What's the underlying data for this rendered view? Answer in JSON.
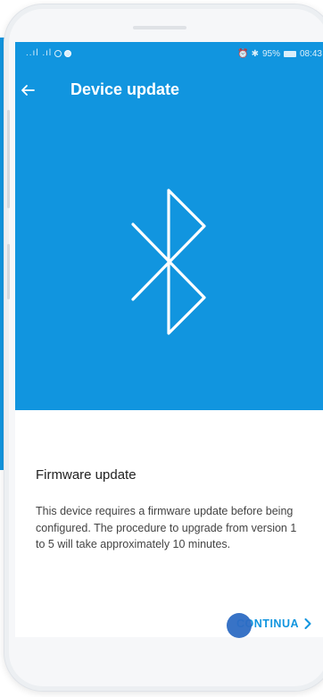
{
  "status_bar": {
    "left_signal": "..ıl .ıl",
    "right_icons": "⏰ ✱ ",
    "battery": "95%",
    "time": "08:43"
  },
  "app_bar": {
    "title": "Device update",
    "back_icon": "arrow-left-icon"
  },
  "hero": {
    "icon": "bluetooth-icon"
  },
  "content": {
    "heading": "Firmware update",
    "description": "This device requires a firmware update before being configured. The procedure to upgrade from version 1 to 5 will take approximately 10 minutes."
  },
  "footer": {
    "continue_label": "CONTINUA",
    "continue_icon": "chevron-right-icon"
  },
  "colors": {
    "primary": "#1195df",
    "touch_indicator": "#2d6bc3"
  }
}
